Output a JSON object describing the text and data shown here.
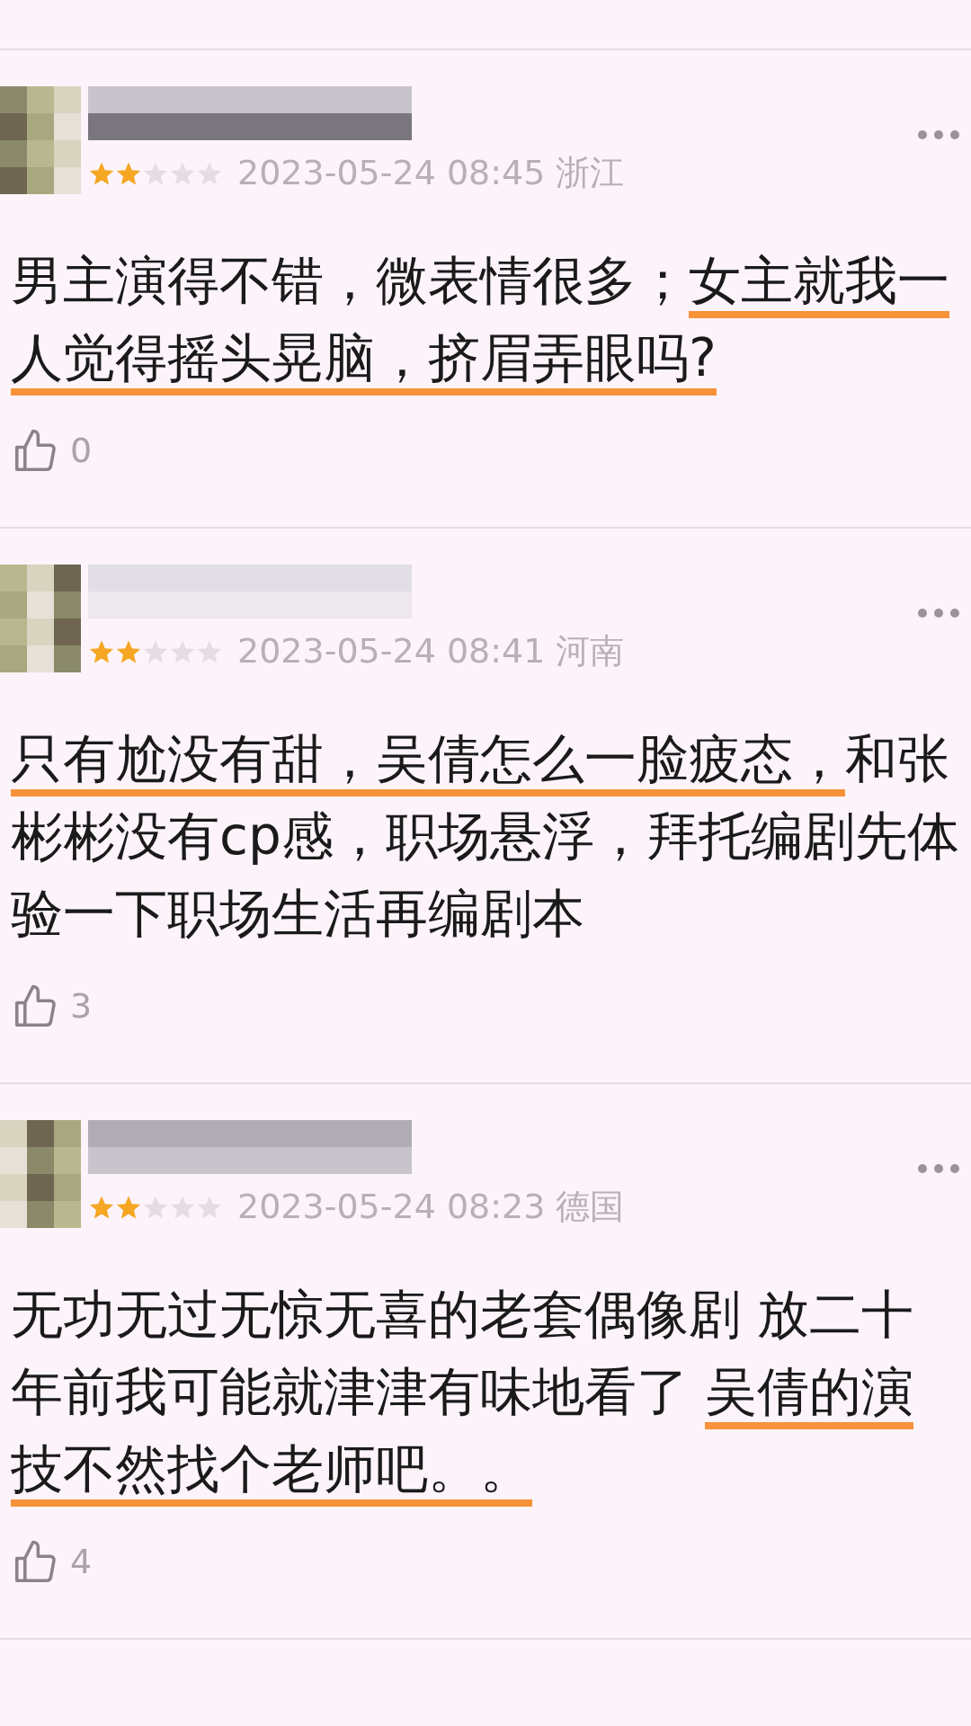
{
  "comments": [
    {
      "stars": 2,
      "time": "2023-05-24 08:45",
      "location": "浙江",
      "text": [
        {
          "text": "男主演得不错，微表情很多；",
          "underlined": false
        },
        {
          "text": "女主就我一人觉得摇头晃脑，挤眉弄眼吗?",
          "underlined": true
        }
      ],
      "likes": "0"
    },
    {
      "stars": 2,
      "time": "2023-05-24 08:41",
      "location": "河南",
      "text": [
        {
          "text": "只有尬没有甜，吴倩怎么一脸疲态，",
          "underlined": true
        },
        {
          "text": "和张彬彬没有cp感，职场悬浮，拜托编剧先体验一下职场生活再编剧本",
          "underlined": false
        }
      ],
      "likes": "3"
    },
    {
      "stars": 2,
      "time": "2023-05-24 08:23",
      "location": "德国",
      "text": [
        {
          "text": "无功无过无惊无喜的老套偶像剧 放二十年前我可能就津津有味地看了 ",
          "underlined": false
        },
        {
          "text": "吴倩的演技不然找个老师吧。。",
          "underlined": true
        }
      ],
      "likes": "4"
    }
  ]
}
